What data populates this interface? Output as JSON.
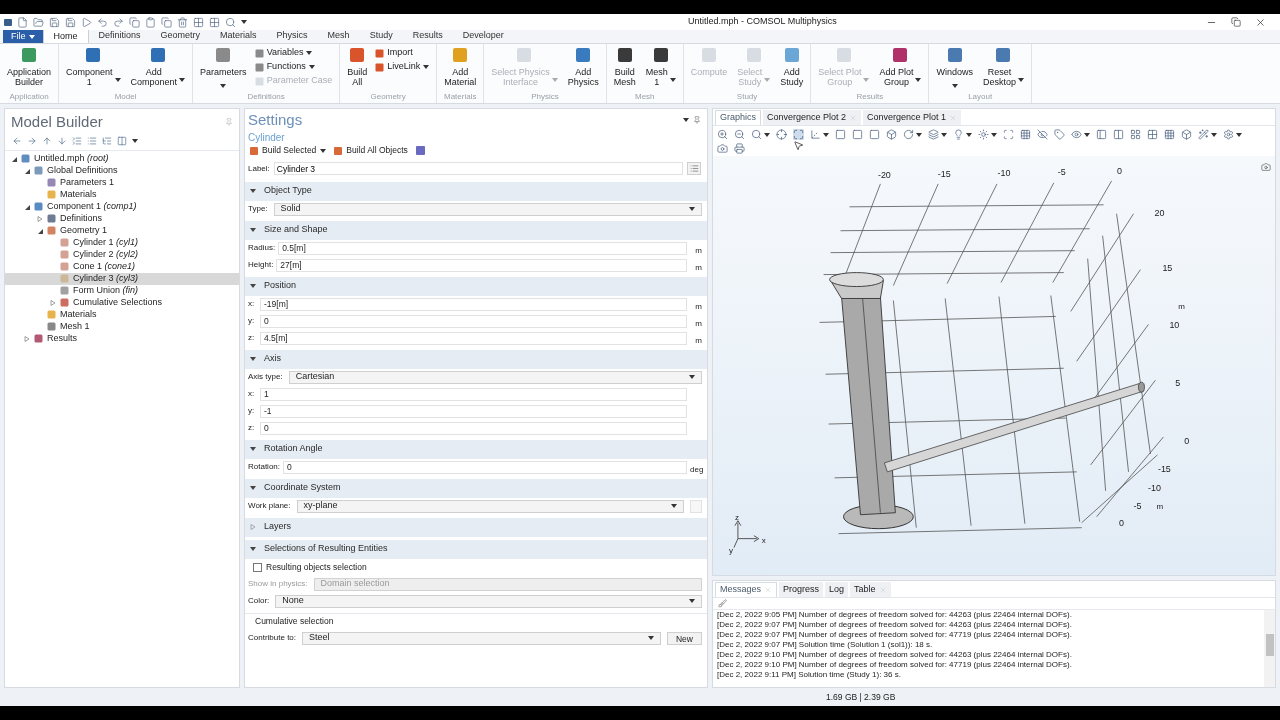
{
  "window": {
    "title": "Untitled.mph - COMSOL Multiphysics"
  },
  "file_menu": "File",
  "menu_tabs": [
    {
      "label": "Home",
      "selected": true
    },
    {
      "label": "Definitions",
      "selected": false
    },
    {
      "label": "Geometry",
      "selected": false
    },
    {
      "label": "Materials",
      "selected": false
    },
    {
      "label": "Physics",
      "selected": false
    },
    {
      "label": "Mesh",
      "selected": false
    },
    {
      "label": "Study",
      "selected": false
    },
    {
      "label": "Results",
      "selected": false
    },
    {
      "label": "Developer",
      "selected": false
    }
  ],
  "ribbon": [
    {
      "label": "Application",
      "buttons": [
        {
          "kind": "large",
          "label": "Application\nBuilder",
          "disabled": false,
          "dropdown": false
        }
      ]
    },
    {
      "label": "Model",
      "buttons": [
        {
          "kind": "large",
          "label": "Component\n1",
          "disabled": false,
          "dropdown": true
        },
        {
          "kind": "large",
          "label": "Add\nComponent",
          "disabled": false,
          "dropdown": true
        }
      ]
    },
    {
      "label": "Definitions",
      "buttons": [
        {
          "kind": "large",
          "label": "Parameters",
          "disabled": false,
          "dropdown": true
        },
        {
          "kind": "small",
          "label": "Variables",
          "disabled": false,
          "dropdown": true
        },
        {
          "kind": "small",
          "label": "Functions",
          "disabled": false,
          "dropdown": true
        },
        {
          "kind": "small",
          "label": "Parameter Case",
          "disabled": true,
          "dropdown": false
        }
      ]
    },
    {
      "label": "Geometry",
      "buttons": [
        {
          "kind": "large",
          "label": "Build\nAll",
          "disabled": false,
          "dropdown": false
        },
        {
          "kind": "small",
          "label": "Import",
          "disabled": false,
          "dropdown": false
        },
        {
          "kind": "small",
          "label": "LiveLink",
          "disabled": false,
          "dropdown": true
        }
      ]
    },
    {
      "label": "Materials",
      "buttons": [
        {
          "kind": "large",
          "label": "Add\nMaterial",
          "disabled": false,
          "dropdown": false
        }
      ]
    },
    {
      "label": "Physics",
      "buttons": [
        {
          "kind": "large",
          "label": "Select Physics\nInterface",
          "disabled": true,
          "dropdown": true
        },
        {
          "kind": "large",
          "label": "Add\nPhysics",
          "disabled": false,
          "dropdown": false
        }
      ]
    },
    {
      "label": "Mesh",
      "buttons": [
        {
          "kind": "large",
          "label": "Build\nMesh",
          "disabled": false,
          "dropdown": false
        },
        {
          "kind": "large",
          "label": "Mesh\n1",
          "disabled": false,
          "dropdown": true
        }
      ]
    },
    {
      "label": "Study",
      "buttons": [
        {
          "kind": "large",
          "label": "Compute",
          "disabled": true,
          "dropdown": false
        },
        {
          "kind": "large",
          "label": "Select\nStudy",
          "disabled": true,
          "dropdown": true
        },
        {
          "kind": "large",
          "label": "Add\nStudy",
          "disabled": false,
          "dropdown": false
        }
      ]
    },
    {
      "label": "Results",
      "buttons": [
        {
          "kind": "large",
          "label": "Select Plot\nGroup",
          "disabled": true,
          "dropdown": true
        },
        {
          "kind": "large",
          "label": "Add Plot\nGroup",
          "disabled": false,
          "dropdown": true
        }
      ]
    },
    {
      "label": "Layout",
      "buttons": [
        {
          "kind": "large",
          "label": "Windows",
          "disabled": false,
          "dropdown": true
        },
        {
          "kind": "large",
          "label": "Reset\nDesktop",
          "disabled": false,
          "dropdown": true
        }
      ]
    }
  ],
  "model_builder": {
    "title": "Model Builder",
    "tree": [
      {
        "label": "Untitled.mph *(root)*",
        "selected": false,
        "expanded": true,
        "children": [
          {
            "label": "Global Definitions",
            "selected": false,
            "expanded": true,
            "children": [
              {
                "label": "Parameters 1",
                "selected": false
              },
              {
                "label": "Materials",
                "selected": false
              }
            ]
          },
          {
            "label": "Component 1 *(comp1)*",
            "selected": false,
            "expanded": true,
            "children": [
              {
                "label": "Definitions",
                "selected": false,
                "expanded": false
              },
              {
                "label": "Geometry 1",
                "selected": false,
                "expanded": true,
                "children": [
                  {
                    "label": "Cylinder 1 *(cyl1)*",
                    "selected": false
                  },
                  {
                    "label": "Cylinder 2 *(cyl2)*",
                    "selected": false
                  },
                  {
                    "label": "Cone 1 *(cone1)*",
                    "selected": false
                  },
                  {
                    "label": "Cylinder 3 *(cyl3)*",
                    "selected": true
                  },
                  {
                    "label": "Form Union *(fin)*",
                    "selected": false
                  },
                  {
                    "label": "Cumulative Selections",
                    "selected": false,
                    "expanded": false
                  }
                ]
              },
              {
                "label": "Materials",
                "selected": false
              },
              {
                "label": "Mesh 1",
                "selected": false
              }
            ]
          },
          {
            "label": "Results",
            "selected": false,
            "expanded": false
          }
        ]
      }
    ]
  },
  "settings": {
    "title": "Settings",
    "subtitle": "Cylinder",
    "actions": [
      {
        "label": "Build Selected",
        "dropdown": true
      },
      {
        "label": "Build All Objects",
        "dropdown": false
      }
    ],
    "label_field": {
      "label": "Label:",
      "value": "Cylinder 3"
    },
    "sections": [
      {
        "title": "Object Type",
        "expanded": true,
        "rows": [
          {
            "kind": "select",
            "label": "Type:",
            "value": "Solid"
          }
        ]
      },
      {
        "title": "Size and Shape",
        "expanded": true,
        "rows": [
          {
            "kind": "field",
            "label": "Radius:",
            "value": "0.5[m]",
            "unit": "m"
          },
          {
            "kind": "field",
            "label": "Height:",
            "value": "27[m]",
            "unit": "m"
          }
        ]
      },
      {
        "title": "Position",
        "expanded": true,
        "rows": [
          {
            "kind": "field",
            "label": "x:",
            "value": "-19[m]",
            "unit": "m"
          },
          {
            "kind": "field",
            "label": "y:",
            "value": "0",
            "unit": "m"
          },
          {
            "kind": "field",
            "label": "z:",
            "value": "4.5[m]",
            "unit": "m"
          }
        ]
      },
      {
        "title": "Axis",
        "expanded": true,
        "rows": [
          {
            "kind": "select",
            "label": "Axis type:",
            "value": "Cartesian"
          },
          {
            "kind": "field",
            "label": "x:",
            "value": "1"
          },
          {
            "kind": "field",
            "label": "y:",
            "value": "-1"
          },
          {
            "kind": "field",
            "label": "z:",
            "value": "0"
          }
        ]
      },
      {
        "title": "Rotation Angle",
        "expanded": true,
        "rows": [
          {
            "kind": "field",
            "label": "Rotation:",
            "value": "0",
            "unit": "deg"
          }
        ]
      },
      {
        "title": "Coordinate System",
        "expanded": true,
        "rows": [
          {
            "kind": "select",
            "label": "Work plane:",
            "value": "xy-plane",
            "side_button": true
          }
        ]
      },
      {
        "title": "Layers",
        "expanded": false
      },
      {
        "title": "Selections of Resulting Entities",
        "expanded": true,
        "rows": [
          {
            "kind": "checkbox",
            "label": "Resulting objects selection",
            "checked": false
          },
          {
            "kind": "select",
            "label": "Show in physics:",
            "value": "Domain selection",
            "disabled": true
          },
          {
            "kind": "select",
            "label": "Color:",
            "value": "None",
            "disabled": false
          },
          {
            "kind": "group",
            "label": "Cumulative selection"
          },
          {
            "kind": "select",
            "label": "Contribute to:",
            "value": "Steel",
            "disabled": false,
            "button": "New"
          }
        ]
      }
    ]
  },
  "graphics": {
    "tabs": [
      {
        "label": "Graphics",
        "selected": true,
        "closable": false
      },
      {
        "label": "Convergence Plot 2",
        "selected": false,
        "closable": true
      },
      {
        "label": "Convergence Plot 1",
        "selected": false,
        "closable": true
      }
    ],
    "x_ticks": [
      "-20",
      "-15",
      "-10",
      "-5",
      "0"
    ],
    "z_ticks": [
      "20",
      "15",
      "10",
      "5",
      "0"
    ],
    "z_unit": "m",
    "y_ticks": [
      "-15",
      "-10",
      "-5",
      "0"
    ],
    "y_unit": "m",
    "triad": [
      "z",
      "x",
      "y"
    ]
  },
  "messages": {
    "tabs": [
      {
        "label": "Messages",
        "selected": true,
        "closable": true
      },
      {
        "label": "Progress",
        "selected": false,
        "closable": false
      },
      {
        "label": "Log",
        "selected": false,
        "closable": false
      },
      {
        "label": "Table",
        "selected": false,
        "closable": true
      }
    ],
    "lines": [
      "[Dec 2, 2022 9:05 PM] Number of degrees of freedom solved for: 44263 (plus 22464 internal DOFs).",
      "[Dec 2, 2022 9:07 PM] Number of degrees of freedom solved for: 44263 (plus 22464 internal DOFs).",
      "[Dec 2, 2022 9:07 PM] Number of degrees of freedom solved for: 47719 (plus 22464 internal DOFs).",
      "[Dec 2, 2022 9:07 PM] Solution time (Solution 1 (sol1)): 18 s.",
      "[Dec 2, 2022 9:10 PM] Number of degrees of freedom solved for: 44263 (plus 22464 internal DOFs).",
      "[Dec 2, 2022 9:10 PM] Number of degrees of freedom solved for: 47719 (plus 22464 internal DOFs).",
      "[Dec 2, 2022 9:11 PM] Solution time (Study 1): 36 s."
    ]
  },
  "status_bar": {
    "memory": "1.69 GB | 2.39 GB"
  }
}
